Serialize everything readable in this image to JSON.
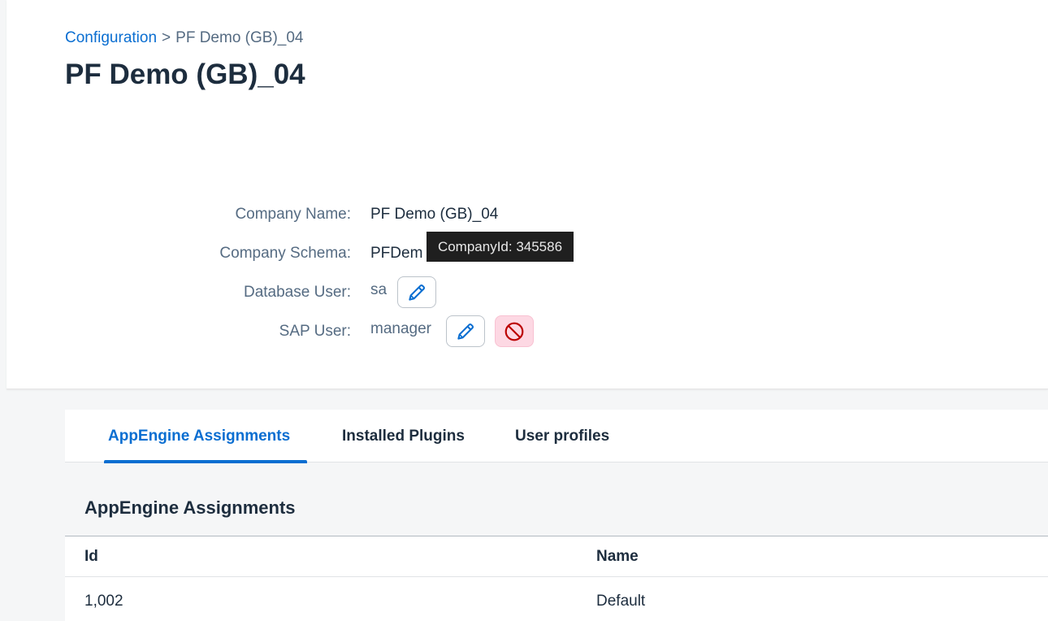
{
  "breadcrumb": {
    "root_link": "Configuration",
    "separator": ">",
    "current": "PF Demo (GB)_04"
  },
  "page_title": "PF Demo (GB)_04",
  "company_details": {
    "company_name_label": "Company Name:",
    "company_name_value": "PF Demo (GB)_04",
    "company_schema_label": "Company Schema:",
    "company_schema_value": "PFDem",
    "database_user_label": "Database User:",
    "database_user_value": "sa",
    "sap_user_label": "SAP User:",
    "sap_user_value": "manager"
  },
  "tooltip": {
    "text": "CompanyId: 345586"
  },
  "tabs": [
    {
      "label": "AppEngine Assignments",
      "active": true
    },
    {
      "label": "Installed Plugins",
      "active": false
    },
    {
      "label": "User profiles",
      "active": false
    }
  ],
  "section": {
    "title": "AppEngine Assignments"
  },
  "table": {
    "columns": [
      "Id",
      "Name"
    ],
    "rows": [
      {
        "id": "1,002",
        "name": "Default"
      }
    ]
  },
  "icons": {
    "edit": "pencil-icon",
    "remove": "cancel-icon"
  },
  "colors": {
    "accent": "#0a6ed1",
    "danger": "#bb0000",
    "danger_bg": "#fdd8e3"
  }
}
